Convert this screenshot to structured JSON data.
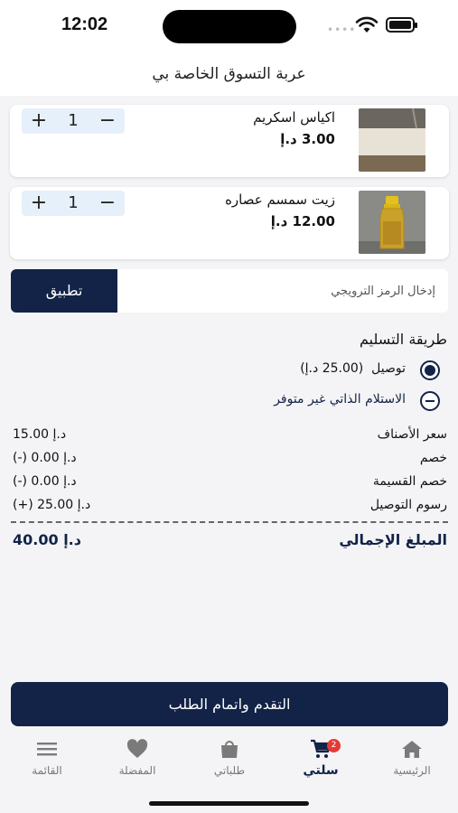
{
  "status_bar": {
    "time": "12:02"
  },
  "header": {
    "title": "عربة التسوق الخاصة بي"
  },
  "cart": {
    "items": [
      {
        "name": "اكياس اسكريم",
        "price": "3.00 د.إ",
        "quantity": "1",
        "plus": "+",
        "minus": "−",
        "image": "ice-cream-bags-photo"
      },
      {
        "name": "زيت سمسم عصاره",
        "price": "12.00 د.إ",
        "quantity": "1",
        "plus": "+",
        "minus": "−",
        "image": "sesame-oil-bottle-photo"
      }
    ]
  },
  "promo": {
    "placeholder": "إدخال الرمز الترويجي",
    "apply_label": "تطبيق"
  },
  "delivery": {
    "title": "طريقة التسليم",
    "options": [
      {
        "label": "توصيل",
        "extra": "(25.00 د.إ)",
        "state": "selected"
      },
      {
        "label": "الاستلام الذاتي غير متوفر",
        "extra": "",
        "state": "disabled"
      }
    ]
  },
  "summary": {
    "rows": [
      {
        "label": "سعر الأصناف",
        "value": "15.00 د.إ"
      },
      {
        "label": "خصم",
        "value": "(-)  0.00 د.إ"
      },
      {
        "label": "خصم القسيمة",
        "value": "(-)  0.00 د.إ"
      },
      {
        "label": "رسوم التوصيل",
        "value": "(+)  25.00 د.إ"
      }
    ],
    "total_label": "المبلغ الإجمالي",
    "total_value": "40.00 د.إ"
  },
  "checkout_label": "التقدم واتمام الطلب",
  "tabbar": {
    "tabs": [
      {
        "label": "الرئيسية",
        "icon": "home-icon"
      },
      {
        "label": "سلتي",
        "icon": "cart-icon",
        "badge": "2",
        "active": true
      },
      {
        "label": "طلباتي",
        "icon": "shopping-bag-icon"
      },
      {
        "label": "المفضلة",
        "icon": "heart-icon"
      },
      {
        "label": "القائمة",
        "icon": "menu-icon"
      }
    ]
  },
  "colors": {
    "primary": "#122347",
    "stepper_bg": "#e6f0fb",
    "badge": "#e53935",
    "page_bg": "#f4f4f6"
  }
}
